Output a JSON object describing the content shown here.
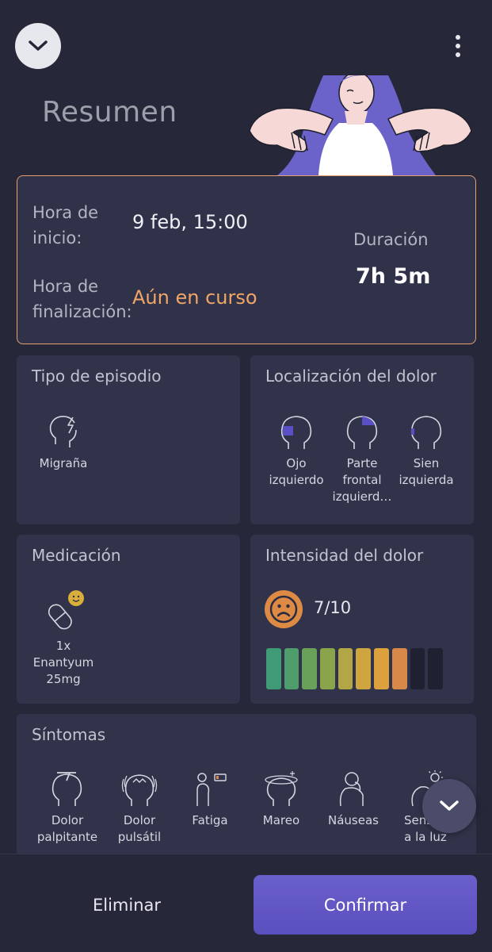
{
  "header": {
    "title": "Resumen"
  },
  "times": {
    "start_label_1": "Hora de",
    "start_label_2": "inicio:",
    "start_value": "9 feb, 15:00",
    "end_label_1": "Hora de",
    "end_label_2": "finalización:",
    "end_value": "Aún en curso",
    "duration_label": "Duración",
    "duration_value": "7h 5m"
  },
  "episode": {
    "title": "Tipo de episodio",
    "items": [
      {
        "label": "Migraña",
        "icon": "head-lightning-icon"
      }
    ]
  },
  "location": {
    "title": "Localización del dolor",
    "items": [
      {
        "label_1": "Ojo",
        "label_2": "izquierdo"
      },
      {
        "label_1": "Parte",
        "label_2": "frontal",
        "label_3": "izquierd…"
      },
      {
        "label_1": "Sien",
        "label_2": "izquierda"
      }
    ]
  },
  "medication": {
    "title": "Medicación",
    "qty": "1x",
    "name": "Enantyum",
    "dose": "25mg"
  },
  "intensity": {
    "title": "Intensidad del dolor",
    "value_text": "7/10",
    "level": 7,
    "max": 10,
    "colors": [
      "#3f9a76",
      "#4f9d6c",
      "#6aa15a",
      "#8aa44c",
      "#b2a744",
      "#cfa53f",
      "#dca13d",
      "#d8894a",
      "#1f2030",
      "#1f2030"
    ]
  },
  "symptoms": {
    "title": "Síntomas",
    "items": [
      {
        "label_1": "Dolor",
        "label_2": "palpitante"
      },
      {
        "label_1": "Dolor",
        "label_2": "pulsátil"
      },
      {
        "label_1": "Fatiga",
        "label_2": ""
      },
      {
        "label_1": "Mareo",
        "label_2": ""
      },
      {
        "label_1": "Náuseas",
        "label_2": ""
      },
      {
        "label_1": "Sensibi",
        "label_2": "a la luz"
      }
    ]
  },
  "actions": {
    "delete": "Eliminar",
    "confirm": "Confirmar"
  },
  "colors": {
    "accent": "#5f55c4",
    "highlight": "#f1a566",
    "background": "#262739",
    "card": "#31334a"
  }
}
